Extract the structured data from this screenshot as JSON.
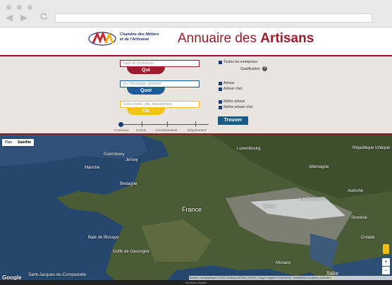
{
  "header": {
    "org_line": "Chambre des Métiers\net de l'Artisanat",
    "title_a": "Annuaire des ",
    "title_b": "Artisans"
  },
  "search": {
    "qui_placeholder": "Nom de l'entreprise",
    "qui_label": "Qui",
    "quoi_placeholder": "Ex : Boulanger, plombier",
    "quoi_label": "Quoi",
    "ou_placeholder": "Code postal, ville, département",
    "ou_label": "Où",
    "toutes": "Toutes les entreprises",
    "qualification": "Qualification",
    "artisan": "Artisan",
    "artisan_art": "Artisan d'art",
    "maitre": "Maître artisan",
    "maitre_art": "Maître artisan d'art",
    "trouver": "Trouver",
    "scale": [
      "Commune",
      "Canton",
      "Arrondissement",
      "Département"
    ]
  },
  "map": {
    "type_plan": "Plan",
    "type_sat": "Satellite",
    "labels": [
      "Guernesey",
      "Jersey",
      "Luxembourg",
      "République tchèque",
      "Allemagne",
      "Liechtenstein",
      "Autriche",
      "France",
      "Suisse",
      "Slovénie",
      "Croatie",
      "Italie",
      "Monaco",
      "Saint-Jacques-de-Compostelle",
      "Baie de Biscaye",
      "Golfe de Gascogne",
      "Manche",
      "Bretagne"
    ],
    "google": "Google",
    "attribution": "Données cartographiques ©2016 GeoBasis-DE/BKG (©2009), Google Imagerie ©2016 NASA, TerraMetrics  Conditions d'utilisation",
    "footer": "Mentions légales",
    "zoom_in": "+",
    "zoom_out": "−"
  },
  "colors": {
    "brand_red": "#9b1c2c",
    "brand_blue": "#1c3d73"
  }
}
